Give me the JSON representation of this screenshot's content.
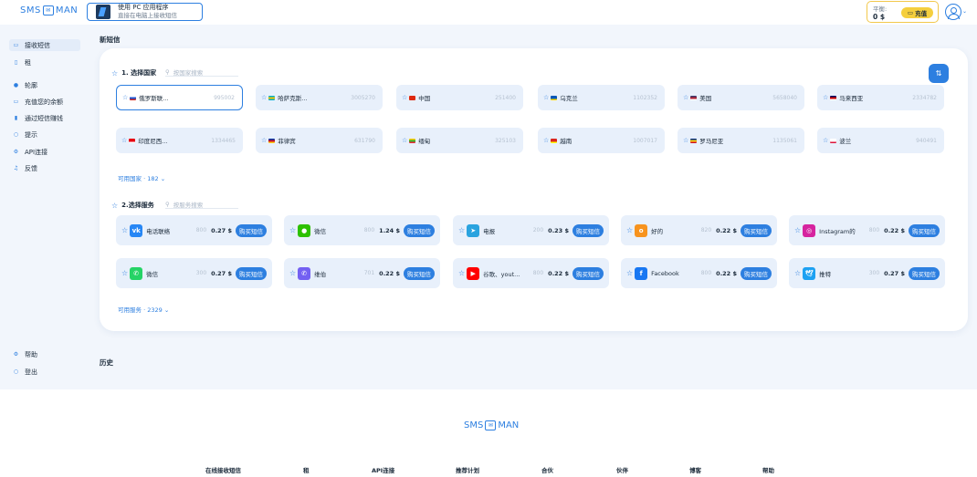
{
  "header": {
    "logo_left": "SMS",
    "logo_right": "MAN",
    "app_banner": {
      "line1": "使用 PC 应用程序",
      "line2": "直接在电脑上接收短信"
    },
    "balance": {
      "label": "平衡:",
      "amount": "0 $",
      "topup_label": "充值"
    }
  },
  "sidebar": {
    "items": [
      {
        "label": "接收短信",
        "icon": "message-icon"
      },
      {
        "label": "租",
        "icon": "phone-icon"
      },
      {
        "label": "轮廓",
        "icon": "user-icon"
      },
      {
        "label": "充值您的余额",
        "icon": "wallet-icon"
      },
      {
        "label": "通过短信赚钱",
        "icon": "chart-icon"
      },
      {
        "label": "提示",
        "icon": "hint-icon"
      },
      {
        "label": "API连接",
        "icon": "api-icon"
      },
      {
        "label": "反馈",
        "icon": "feedback-icon"
      }
    ],
    "bottom": [
      {
        "label": "帮助",
        "icon": "help-icon"
      },
      {
        "label": "登出",
        "icon": "logout-icon"
      }
    ]
  },
  "main": {
    "title": "新短信",
    "countries_section": {
      "heading": "1. 选择国家",
      "search_placeholder": "按国家搜索",
      "countries": [
        {
          "name": "俄罗斯联...",
          "count": "995002",
          "flag": [
            "#ffffff",
            "#1c57d6",
            "#d52b1e"
          ]
        },
        {
          "name": "哈萨克斯...",
          "count": "3005270",
          "flag": [
            "#00afca",
            "#f5c400",
            "#00afca"
          ]
        },
        {
          "name": "中国",
          "count": "251400",
          "flag": [
            "#de2910",
            "#de2910",
            "#de2910"
          ]
        },
        {
          "name": "乌克兰",
          "count": "1102352",
          "flag": [
            "#0057b7",
            "#0057b7",
            "#ffd700"
          ]
        },
        {
          "name": "美国",
          "count": "5658040",
          "flag": [
            "#3c3b6e",
            "#b22234",
            "#ffffff"
          ]
        },
        {
          "name": "马来西亚",
          "count": "2334782",
          "flag": [
            "#010066",
            "#cc0001",
            "#ffffff"
          ]
        },
        {
          "name": "印度尼西...",
          "count": "1334465",
          "flag": [
            "#e70011",
            "#e70011",
            "#ffffff"
          ]
        },
        {
          "name": "菲律宾",
          "count": "631790",
          "flag": [
            "#0038a8",
            "#ce1126",
            "#fcd116"
          ]
        },
        {
          "name": "缅甸",
          "count": "325103",
          "flag": [
            "#fecb00",
            "#34b233",
            "#ea2839"
          ]
        },
        {
          "name": "越南",
          "count": "1007017",
          "flag": [
            "#da251d",
            "#da251d",
            "#ffff00"
          ]
        },
        {
          "name": "罗马尼亚",
          "count": "1135061",
          "flag": [
            "#002b7f",
            "#fcd116",
            "#ce1126"
          ]
        },
        {
          "name": "波兰",
          "count": "940491",
          "flag": [
            "#ffffff",
            "#ffffff",
            "#dc143c"
          ]
        }
      ],
      "more_label": "可用国家 · 182"
    },
    "services_section": {
      "heading": "2.选择服务",
      "search_placeholder": "按服务搜索",
      "buy_label": "购买短信",
      "services": [
        {
          "name": "电话联络",
          "count": "800",
          "price": "0.27 $",
          "icon": "vk-icon",
          "color": "#2787f5",
          "glyph": "vk"
        },
        {
          "name": "微信",
          "count": "800",
          "price": "1.24 $",
          "icon": "wechat-icon",
          "color": "#2dc100",
          "glyph": "●"
        },
        {
          "name": "电报",
          "count": "200",
          "price": "0.23 $",
          "icon": "telegram-icon",
          "color": "#2aa3df",
          "glyph": "➤"
        },
        {
          "name": "好的",
          "count": "820",
          "price": "0.22 $",
          "icon": "ok-icon",
          "color": "#f7931e",
          "glyph": "o"
        },
        {
          "name": "Instagram的",
          "count": "800",
          "price": "0.22 $",
          "icon": "instagram-icon",
          "color": "#d6249f",
          "glyph": "◎"
        },
        {
          "name": "微信",
          "count": "300",
          "price": "0.27 $",
          "icon": "whatsapp-icon",
          "color": "#25d366",
          "glyph": "✆"
        },
        {
          "name": "维伯",
          "count": "701",
          "price": "0.22 $",
          "icon": "viber-icon",
          "color": "#7360f2",
          "glyph": "✆"
        },
        {
          "name": "谷歌、yout...",
          "count": "800",
          "price": "0.22 $",
          "icon": "youtube-icon",
          "color": "#ff0000",
          "glyph": "▶"
        },
        {
          "name": "Facebook",
          "count": "800",
          "price": "0.22 $",
          "icon": "facebook-icon",
          "color": "#1877f2",
          "glyph": "f"
        },
        {
          "name": "推特",
          "count": "300",
          "price": "0.27 $",
          "icon": "twitter-icon",
          "color": "#1da1f2",
          "glyph": "🕊"
        }
      ],
      "more_label": "可用服务 · 2329"
    },
    "history_title": "历史"
  },
  "footer": {
    "logo_left": "SMS",
    "logo_right": "MAN",
    "links": [
      "在线接收短信",
      "租",
      "API连接",
      "推荐计划",
      "合伙",
      "伙伴",
      "博客",
      "帮助"
    ]
  },
  "colors": {
    "accent": "#2d7fe0",
    "balance_border": "#f2c84b",
    "topup": "#f5cf3e"
  }
}
